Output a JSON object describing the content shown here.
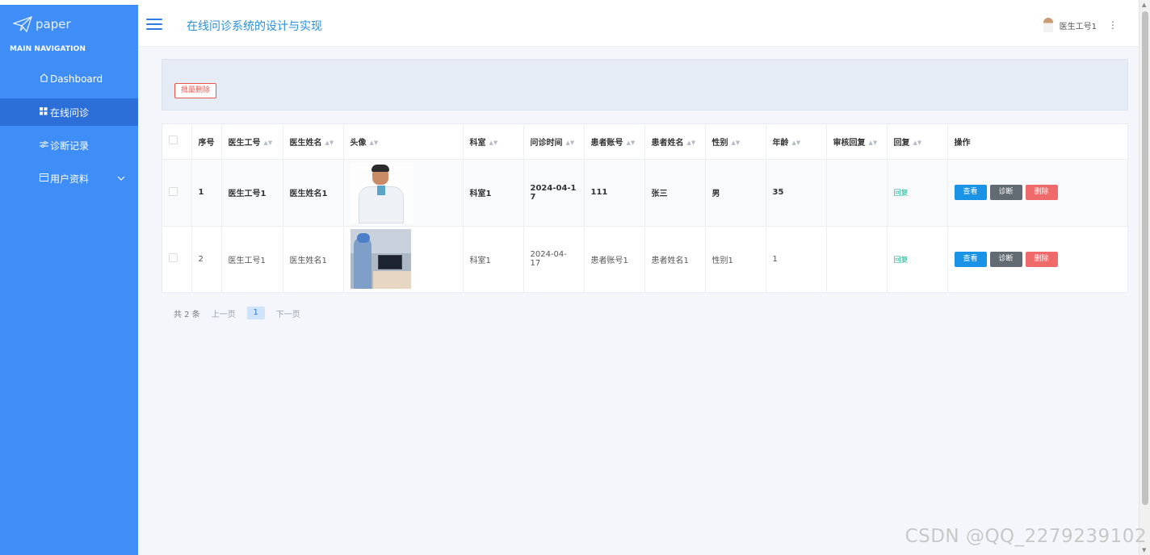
{
  "app": {
    "logo_text": "paper",
    "site_title": "在线问诊系统的设计与实现",
    "user_name": "医生工号1"
  },
  "sidebar": {
    "nav_title": "MAIN NAVIGATION",
    "items": [
      {
        "label": "Dashboard",
        "icon": "home-icon"
      },
      {
        "label": "在线问诊",
        "icon": "grid-icon",
        "active": true
      },
      {
        "label": "诊断记录",
        "icon": "sliders-icon"
      },
      {
        "label": "用户资料",
        "icon": "card-icon",
        "has_children": true
      }
    ]
  },
  "toolbar": {
    "batch_delete_label": "批量删除"
  },
  "table": {
    "headers": [
      "序号",
      "医生工号",
      "医生姓名",
      "头像",
      "科室",
      "问诊时间",
      "患者账号",
      "患者姓名",
      "性别",
      "年龄",
      "审核回复",
      "回复",
      "操作"
    ],
    "rows": [
      {
        "no": "1",
        "doctor_id": "医生工号1",
        "doctor_name": "医生姓名1",
        "dept": "科室1",
        "time_a": "2024-04-1",
        "time_b": "7",
        "patient_account": "111",
        "patient_name": "张三",
        "gender": "男",
        "age": "35",
        "review_reply": "",
        "reply": "回复"
      },
      {
        "no": "2",
        "doctor_id": "医生工号1",
        "doctor_name": "医生姓名1",
        "dept": "科室1",
        "time_a": "2024-04-17",
        "time_b": "",
        "patient_account": "患者账号1",
        "patient_name": "患者姓名1",
        "gender": "性别1",
        "age": "1",
        "review_reply": "",
        "reply": "回复"
      }
    ],
    "actions": {
      "view": "查看",
      "diagnose": "诊断",
      "delete": "删除"
    }
  },
  "pager": {
    "total": "共 2 条",
    "prev": "上一页",
    "current": "1",
    "next": "下一页"
  },
  "watermark": "CSDN @QQ_2279239102",
  "colors": {
    "sidebar": "#3f8df6",
    "sidebar_active": "#2d6fd9",
    "title": "#2b8fd8",
    "view_button": "#1a92e6",
    "diagnose_button": "#626a72",
    "delete_button": "#ef6b6b",
    "reply_link": "#1ab394"
  }
}
